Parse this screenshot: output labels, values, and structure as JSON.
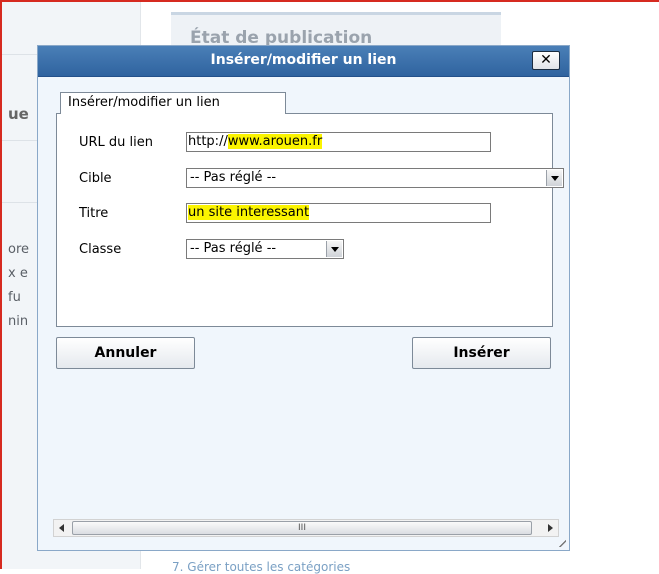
{
  "background": {
    "panel_title": "État de publication",
    "sidebar_fragments": [
      "ue",
      "ore",
      "x e",
      "fu",
      "nin"
    ],
    "bottom_link": "7. Gérer toutes les catégories"
  },
  "dialog": {
    "title": "Insérer/modifier un lien",
    "close_label": "✕",
    "tab_label": "Insérer/modifier un lien",
    "fields": {
      "url": {
        "label": "URL du lien",
        "prefix": "http://",
        "value": "www.arouen.fr"
      },
      "target": {
        "label": "Cible",
        "value": "-- Pas réglé --"
      },
      "title": {
        "label": "Titre",
        "value": "un site interessant"
      },
      "class": {
        "label": "Classe",
        "value": "-- Pas réglé --"
      }
    },
    "cancel_label": "Annuler",
    "insert_label": "Insérer",
    "scroll_thumb_label": "III"
  },
  "colors": {
    "highlight": "#fbf400",
    "titlebar": "#2f639f",
    "frame_border": "#d62a20"
  }
}
